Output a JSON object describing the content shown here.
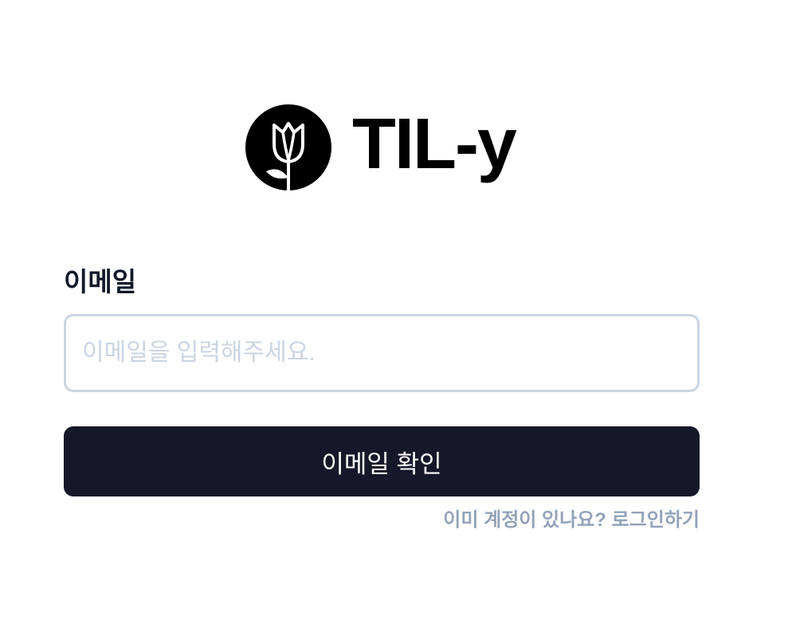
{
  "brand": {
    "logo_icon": "tulip-icon",
    "name": "TIL-y"
  },
  "form": {
    "email_label": "이메일",
    "email_value": "",
    "email_placeholder": "이메일을 입력해주세요.",
    "confirm_button_label": "이메일 확인"
  },
  "footer": {
    "login_link_label": "이미 계정이 있나요? 로그인하기"
  },
  "colors": {
    "primary_button": "#141828",
    "input_border": "#cbd5e1",
    "muted_link": "#94a3b8",
    "label_text": "#111827"
  }
}
